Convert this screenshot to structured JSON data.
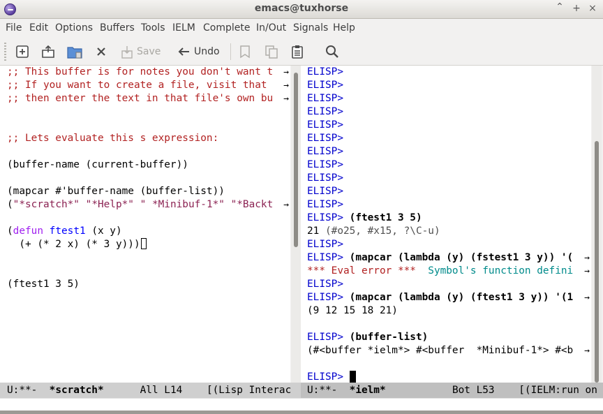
{
  "window": {
    "title": "emacs@tuxhorse",
    "controls": {
      "minimize": "⌃",
      "maximize": "+",
      "close": "×"
    }
  },
  "menubar": {
    "items": [
      "File",
      "Edit",
      "Options",
      "Buffers",
      "Tools",
      "IELM",
      "Complete",
      "In/Out",
      "Signals",
      "Help"
    ]
  },
  "toolbar": {
    "buttons": [
      {
        "icon": "new-file-icon"
      },
      {
        "icon": "open-folder-icon"
      },
      {
        "icon": "dired-folder-icon"
      },
      {
        "icon": "close-x-icon"
      },
      {
        "icon": "save-icon",
        "label": "Save",
        "enabled": false
      },
      {
        "icon": "undo-arrow-icon",
        "label": "Undo",
        "enabled": true
      },
      {
        "icon": "cut-icon",
        "enabled": false
      },
      {
        "icon": "copy-icon",
        "enabled": false
      },
      {
        "icon": "paste-icon",
        "enabled": true
      },
      {
        "icon": "search-icon",
        "enabled": true
      }
    ]
  },
  "left_pane": {
    "lines": [
      ";; This buffer is for notes you don't want t",
      ";; If you want to create a file, visit that ",
      ";; then enter the text in that file's own bu",
      "",
      "",
      ";; Lets evaluate this s expression:",
      "",
      "(buffer-name (current-buffer))",
      "",
      "(mapcar #'buffer-name (buffer-list))",
      "(\"*scratch*\" \"*Help*\" \" *Minibuf-1*\" \"*Backt",
      "",
      "(defun ftest1 (x y)",
      "  (+ (* 2 x) (* 3 y)))",
      "",
      "",
      "(ftest1 3 5)"
    ],
    "defun_keyword": "defun",
    "defun_name": "ftest1",
    "defun_args": " (x y)",
    "defun_open": "(",
    "scratch_list": {
      "open": "(",
      "s1": "\"*scratch*\"",
      "s2": "\"*Help*\"",
      "s3": "\" *Minibuf-1*\"",
      "s4": "\"*Backt"
    }
  },
  "right_pane": {
    "prompt": "ELISP>",
    "lines": [
      {
        "prompt": "ELISP>",
        "text": ""
      },
      {
        "prompt": "ELISP>",
        "text": ""
      },
      {
        "prompt": "ELISP>",
        "text": ""
      },
      {
        "prompt": "ELISP>",
        "text": ""
      },
      {
        "prompt": "ELISP>",
        "text": ""
      },
      {
        "prompt": "ELISP>",
        "text": ""
      },
      {
        "prompt": "ELISP>",
        "text": ""
      },
      {
        "prompt": "ELISP>",
        "text": ""
      },
      {
        "prompt": "ELISP>",
        "text": ""
      },
      {
        "prompt": "ELISP>",
        "text": ""
      },
      {
        "prompt": "ELISP>",
        "text": ""
      },
      {
        "prompt": "ELISP>",
        "text": "(ftest1 3 5)"
      },
      {
        "result": "21",
        "extra": " (#o25, #x15, ?\\C-u)"
      },
      {
        "prompt": "ELISP>",
        "text": ""
      },
      {
        "prompt": "ELISP>",
        "text": "(mapcar (lambda (y) (fstest1 3 y)) '("
      },
      {
        "error": "*** Eval error ***",
        "message": "  Symbol's function defini"
      },
      {
        "prompt": "ELISP>",
        "text": ""
      },
      {
        "prompt": "ELISP>",
        "text": "(mapcar (lambda (y) (ftest1 3 y)) '(1"
      },
      {
        "result": "(9 12 15 18 21)",
        "extra": ""
      },
      {
        "blank": true
      },
      {
        "prompt": "ELISP>",
        "text": "(buffer-list)"
      },
      {
        "result": "(#<buffer *ielm*> #<buffer  *Minibuf-1*> #<b",
        "extra": ""
      },
      {
        "blank": true
      },
      {
        "prompt": "ELISP>",
        "text": ""
      }
    ]
  },
  "modeline_left": {
    "status": "U:**-  ",
    "buffer": "*scratch*",
    "position": "      All L14    ",
    "mode": "[(Lisp Interac"
  },
  "modeline_right": {
    "status": "U:**-  ",
    "buffer": "*ielm*",
    "position": "           Bot L53    ",
    "mode": "[(IELM:run on"
  },
  "colors": {
    "comment": "#b22222",
    "string": "#8b2252",
    "keyword": "#a020f0",
    "function_name": "#0000ff",
    "prompt": "#0000cd",
    "error": "#b22222",
    "error_message": "#008b8b"
  }
}
